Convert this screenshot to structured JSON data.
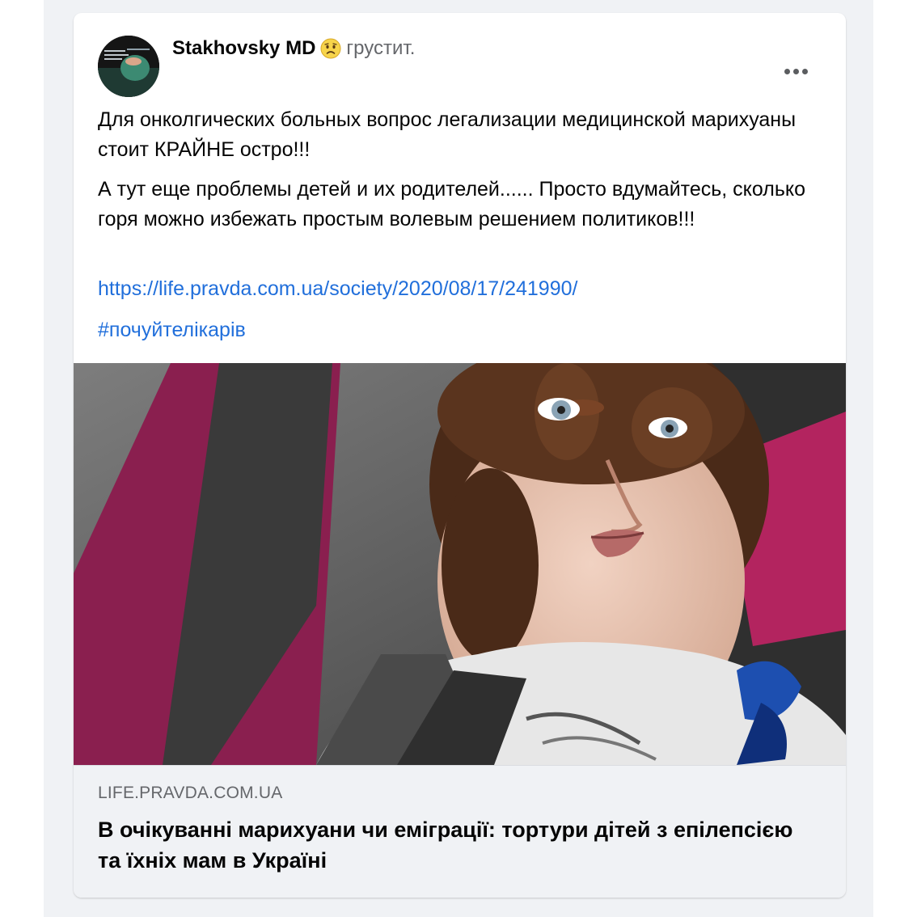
{
  "post": {
    "author": "Stakhovsky MD",
    "feeling": "грустит.",
    "feeling_icon": "sad-face-icon",
    "more_icon": "more-options-icon",
    "paragraphs": [
      "Для онколгических больных вопрос легализации медицинской марихуаны стоит КРАЙНЕ остро!!!",
      "А тут еще проблемы детей и их родителей...... Просто вдумайтесь, сколько горя можно избежать простым волевым решением политиков!!!"
    ],
    "link": "https://life.pravda.com.ua/society/2020/08/17/241990/",
    "hashtag": "#почуйтелікарів"
  },
  "preview": {
    "domain": "LIFE.PRAVDA.COM.UA",
    "title": "В очікуванні марихуани чи еміграції: тортури дітей з епілепсією та їхніх мам в Україні"
  },
  "colors": {
    "link": "#216fdb",
    "text": "#050505",
    "secondary": "#65676b",
    "background": "#f0f2f5"
  }
}
